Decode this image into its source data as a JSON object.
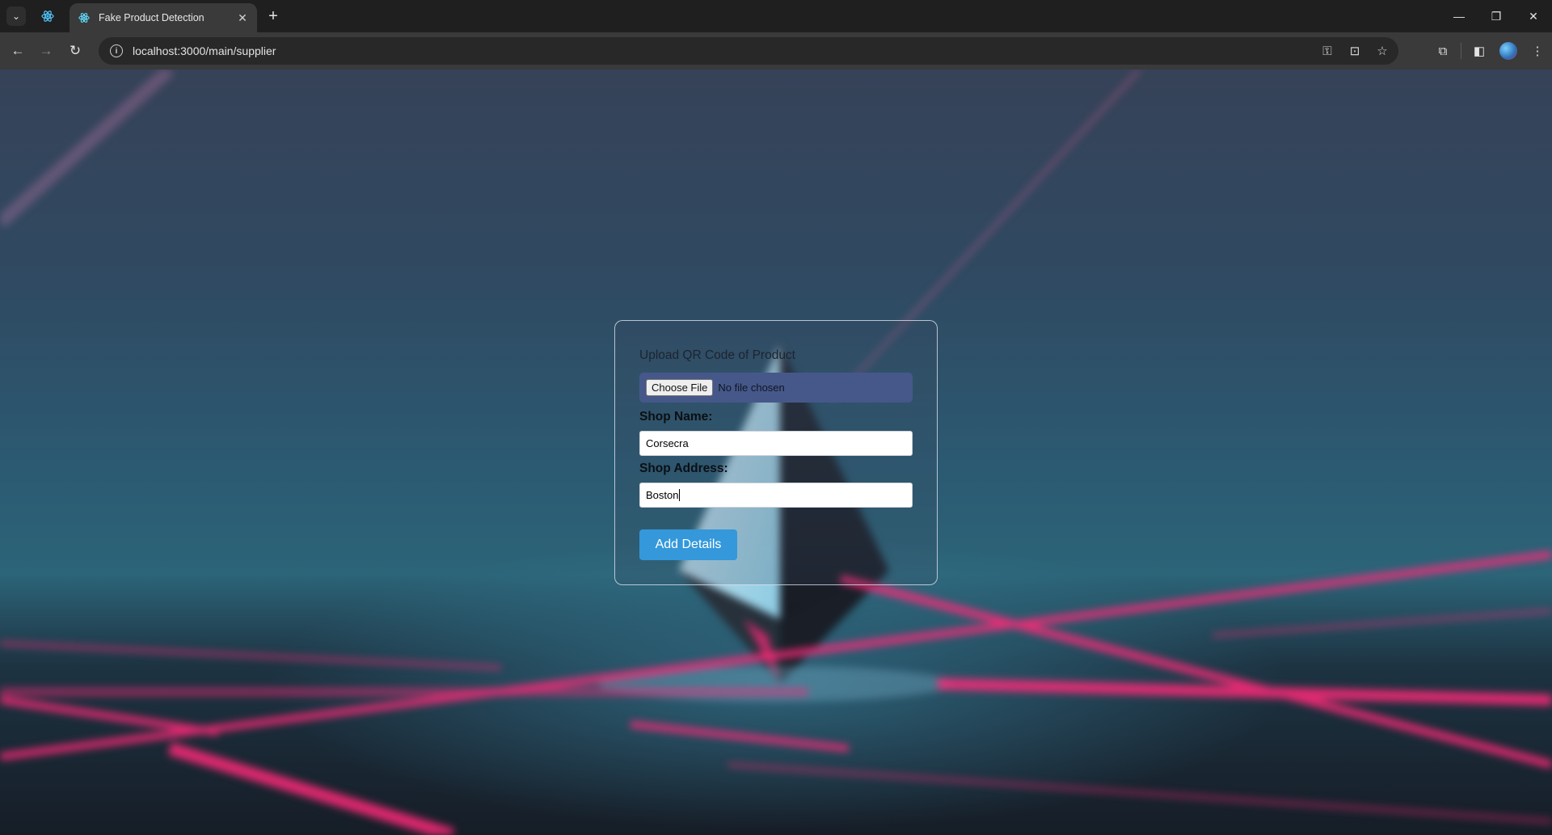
{
  "browser": {
    "tab_title": "Fake Product Detection",
    "url": "localhost:3000/main/supplier",
    "tab_close": "✕",
    "new_tab": "+",
    "window": {
      "minimize": "—",
      "restore": "❐",
      "close": "✕"
    }
  },
  "icons": {
    "tab_search": "chevron-down-icon",
    "pinned_tab": "react-icon",
    "favicon": "react-icon",
    "back": "arrow-left-icon",
    "forward": "arrow-right-icon",
    "reload": "reload-icon",
    "site_info": "info-icon",
    "password": "key-icon",
    "install": "install-icon",
    "bookmark": "star-icon",
    "extensions": "puzzle-icon",
    "side_panel": "side-panel-icon",
    "profile": "avatar",
    "menu": "kebab-menu-icon"
  },
  "form": {
    "upload_label": "Upload QR Code of Product",
    "choose_file_label": "Choose File",
    "file_status": "No file chosen",
    "shop_name_label": "Shop Name:",
    "shop_name_value": "Corsecra",
    "shop_address_label": "Shop Address:",
    "shop_address_value": "Boston",
    "submit_label": "Add Details"
  },
  "colors": {
    "accent_button": "#3498db",
    "file_box": "#46588a",
    "neon_lines": "#ff2a7a"
  }
}
